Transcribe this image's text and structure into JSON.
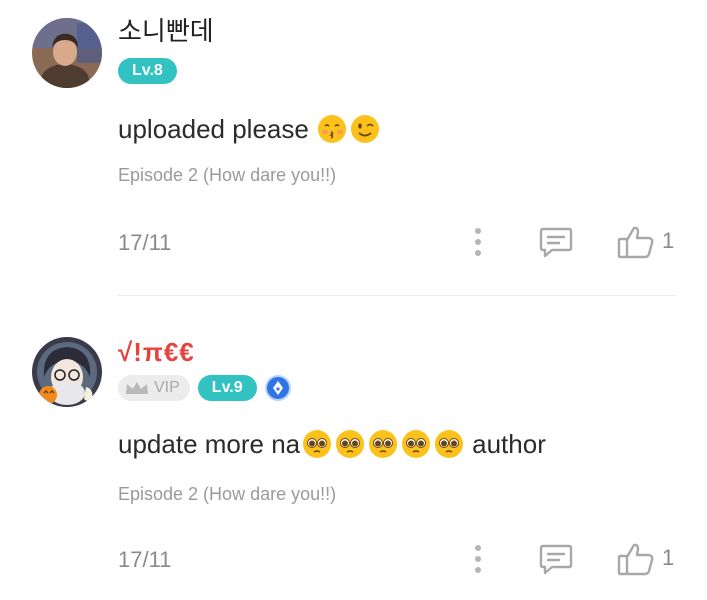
{
  "comments": [
    {
      "username": "소니빤데",
      "level": "Lv.8",
      "text": "uploaded please",
      "emojis": [
        "kissing-face-emoji",
        "winking-face-emoji"
      ],
      "episode": "Episode 2 (How dare you!!)",
      "date": "17/11",
      "likes": "1"
    },
    {
      "username": "√!π€€",
      "vip": "VIP",
      "level": "Lv.9",
      "text_before": "update more na",
      "emojis": [
        "pleading-face-emoji",
        "pleading-face-emoji",
        "pleading-face-emoji",
        "pleading-face-emoji",
        "pleading-face-emoji"
      ],
      "text_after": "author",
      "episode": "Episode 2 (How dare you!!)",
      "date": "17/11",
      "likes": "1"
    }
  ],
  "colors": {
    "level_badge": "#33c2c2",
    "vip_badge_bg": "#ececec",
    "writer_badge": "#2f74e8",
    "username_highlight": "#e5433b",
    "meta_text": "#9a9a9a"
  },
  "icons": [
    "more-vertical-icon",
    "reply-comment-icon",
    "thumbs-up-icon",
    "crown-icon",
    "pen-nib-icon"
  ]
}
